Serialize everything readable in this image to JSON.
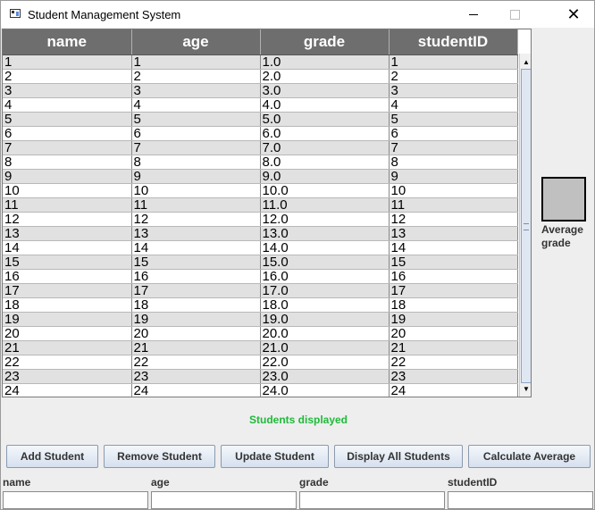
{
  "window": {
    "title": "Student Management System",
    "minimize_glyph": "",
    "close_glyph": "✕"
  },
  "table": {
    "columns": [
      "name",
      "age",
      "grade",
      "studentID"
    ],
    "rows": [
      [
        "1",
        "1",
        "1.0",
        "1"
      ],
      [
        "2",
        "2",
        "2.0",
        "2"
      ],
      [
        "3",
        "3",
        "3.0",
        "3"
      ],
      [
        "4",
        "4",
        "4.0",
        "4"
      ],
      [
        "5",
        "5",
        "5.0",
        "5"
      ],
      [
        "6",
        "6",
        "6.0",
        "6"
      ],
      [
        "7",
        "7",
        "7.0",
        "7"
      ],
      [
        "8",
        "8",
        "8.0",
        "8"
      ],
      [
        "9",
        "9",
        "9.0",
        "9"
      ],
      [
        "10",
        "10",
        "10.0",
        "10"
      ],
      [
        "11",
        "11",
        "11.0",
        "11"
      ],
      [
        "12",
        "12",
        "12.0",
        "12"
      ],
      [
        "13",
        "13",
        "13.0",
        "13"
      ],
      [
        "14",
        "14",
        "14.0",
        "14"
      ],
      [
        "15",
        "15",
        "15.0",
        "15"
      ],
      [
        "16",
        "16",
        "16.0",
        "16"
      ],
      [
        "17",
        "17",
        "17.0",
        "17"
      ],
      [
        "18",
        "18",
        "18.0",
        "18"
      ],
      [
        "19",
        "19",
        "19.0",
        "19"
      ],
      [
        "20",
        "20",
        "20.0",
        "20"
      ],
      [
        "21",
        "21",
        "21.0",
        "21"
      ],
      [
        "22",
        "22",
        "22.0",
        "22"
      ],
      [
        "23",
        "23",
        "23.0",
        "23"
      ],
      [
        "24",
        "24",
        "24.0",
        "24"
      ]
    ],
    "header_color": "#6e6e6e",
    "stripe_color": "#e1e1e1"
  },
  "scrollbar": {
    "up_arrow": "▲",
    "down_arrow": "▼"
  },
  "average": {
    "label": "Average grade",
    "box_color": "#c0c0c0"
  },
  "status": {
    "text": "Students displayed",
    "color": "#1fba3a"
  },
  "buttons": {
    "add": "Add Student",
    "remove": "Remove Student",
    "update": "Update Student",
    "display_all": "Display All Students",
    "calculate_average": "Calculate Average"
  },
  "form": {
    "fields": [
      {
        "label": "name",
        "value": ""
      },
      {
        "label": "age",
        "value": ""
      },
      {
        "label": "grade",
        "value": ""
      },
      {
        "label": "studentID",
        "value": ""
      }
    ]
  },
  "icons": {
    "app": "app-window-icon",
    "minimize": "minimize-icon",
    "maximize": "maximize-icon",
    "close": "close-icon"
  }
}
